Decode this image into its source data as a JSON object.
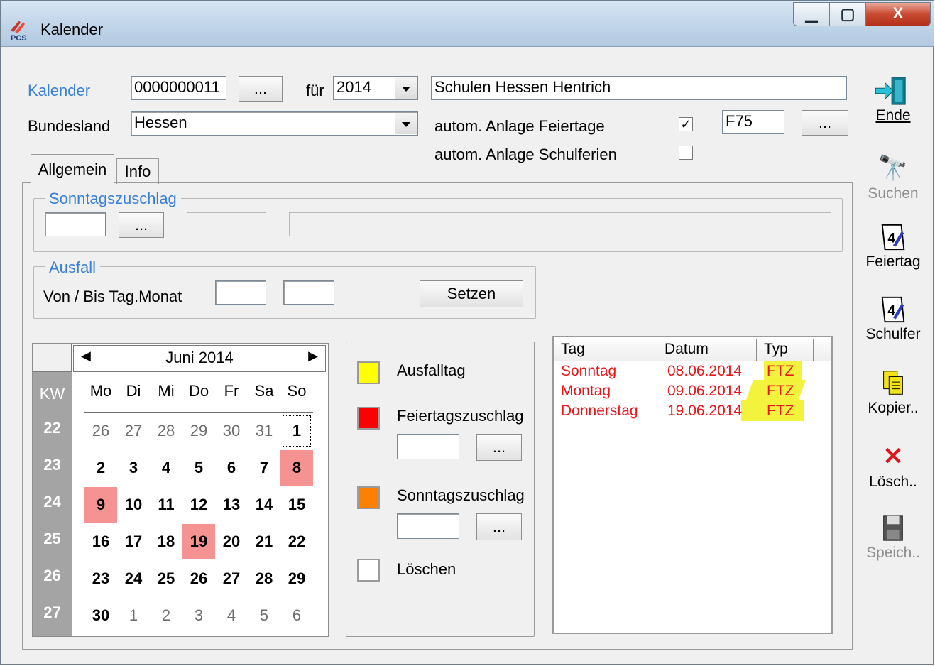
{
  "window": {
    "title": "Kalender",
    "controls": {
      "minimize": "▁",
      "maximize": "▢",
      "close": "X"
    }
  },
  "header": {
    "kalender_label": "Kalender",
    "kalender_value": "0000000011",
    "browse": "...",
    "fuer_label": "für",
    "year_value": "2014",
    "name_value": "Schulen Hessen Hentrich",
    "bundesland_label": "Bundesland",
    "bundesland_value": "Hessen",
    "feiertage_label": "autom. Anlage Feiertage",
    "feiertage_checked": "✓",
    "feiertage_code": "F75",
    "schulferien_label": "autom. Anlage Schulferien"
  },
  "tabs": [
    "Allgemein",
    "Info"
  ],
  "sonntagszuschlag": {
    "title": "Sonntagszuschlag",
    "browse": "..."
  },
  "ausfall": {
    "title": "Ausfall",
    "range_label": "Von / Bis Tag.Monat",
    "set_button": "Setzen"
  },
  "calendar": {
    "month_label": "Juni 2014",
    "kw_label": "KW",
    "weekdays": [
      "Mo",
      "Di",
      "Mi",
      "Do",
      "Fr",
      "Sa",
      "So"
    ],
    "weeks": [
      {
        "kw": "22",
        "days": [
          "26",
          "27",
          "28",
          "29",
          "30",
          "31",
          "1"
        ]
      },
      {
        "kw": "23",
        "days": [
          "2",
          "3",
          "4",
          "5",
          "6",
          "7",
          "8"
        ]
      },
      {
        "kw": "24",
        "days": [
          "9",
          "10",
          "11",
          "12",
          "13",
          "14",
          "15"
        ]
      },
      {
        "kw": "25",
        "days": [
          "16",
          "17",
          "18",
          "19",
          "20",
          "21",
          "22"
        ]
      },
      {
        "kw": "26",
        "days": [
          "23",
          "24",
          "25",
          "26",
          "27",
          "28",
          "29"
        ]
      },
      {
        "kw": "27",
        "days": [
          "30",
          "1",
          "2",
          "3",
          "4",
          "5",
          "6"
        ]
      }
    ]
  },
  "legend": {
    "ausfalltag": "Ausfalltag",
    "feiertagszuschlag": "Feiertagszuschlag",
    "sonntagszuschlag": "Sonntagszuschlag",
    "loeschen": "Löschen",
    "browse": "...",
    "colors": {
      "ausfalltag": "#ffff00",
      "feiertagszuschlag": "#ff0000",
      "sonntagszuschlag": "#ff8000",
      "loeschen": "#ffffff"
    }
  },
  "list": {
    "columns": [
      "Tag",
      "Datum",
      "Typ"
    ],
    "rows": [
      {
        "tag": "Sonntag",
        "datum": "08.06.2014",
        "typ": "FTZ"
      },
      {
        "tag": "Montag",
        "datum": "09.06.2014",
        "typ": "FTZ"
      },
      {
        "tag": "Donnerstag",
        "datum": "19.06.2014",
        "typ": "FTZ"
      }
    ]
  },
  "sidebar": {
    "ende": "Ende",
    "suchen": "Suchen",
    "feiertag": "Feiertag",
    "schulferien": "Schulfer",
    "kopieren": "Kopier..",
    "loeschen": "Lösch..",
    "speichern": "Speich.."
  }
}
